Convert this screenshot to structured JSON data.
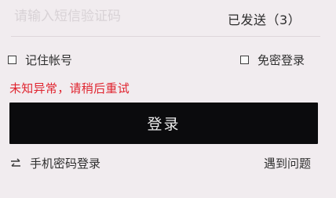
{
  "verification": {
    "code_placeholder": "请输入短信验证码",
    "code_value": "",
    "sent_label": "已发送（3）"
  },
  "options": {
    "remember_label": "记住帐号",
    "remember_checked": false,
    "auto_login_label": "免密登录",
    "auto_login_checked": false
  },
  "error": {
    "message": "未知异常，请稍后重试",
    "color": "#e0242f"
  },
  "login_button": {
    "label": "登录",
    "background": "#0b0b0d"
  },
  "footer": {
    "switch_icon": "swap-arrows-icon",
    "switch_label": "手机密码登录",
    "help_label": "遇到问题"
  }
}
